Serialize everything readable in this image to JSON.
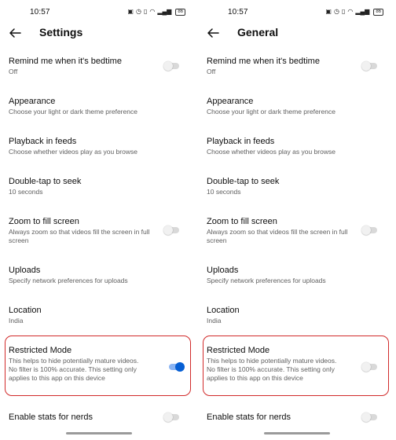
{
  "screens": [
    {
      "status": {
        "time": "10:57",
        "icons": [
          "nfc-icon",
          "alarm-icon",
          "vibrate-icon",
          "wifi-icon",
          "signal-icon"
        ],
        "battery": "86"
      },
      "header": {
        "title": "Settings"
      },
      "settings": [
        {
          "title": "Remind me when it's bedtime",
          "subtitle": "Off",
          "toggle": "off"
        },
        {
          "title": "Appearance",
          "subtitle": "Choose your light or dark theme preference"
        },
        {
          "title": "Playback in feeds",
          "subtitle": "Choose whether videos play as you browse"
        },
        {
          "title": "Double-tap to seek",
          "subtitle": "10 seconds"
        },
        {
          "title": "Zoom to fill screen",
          "subtitle": "Always zoom so that videos fill the screen in full screen",
          "toggle": "off"
        },
        {
          "title": "Uploads",
          "subtitle": "Specify network preferences for uploads"
        },
        {
          "title": "Location",
          "subtitle": "India"
        },
        {
          "title": "Restricted Mode",
          "subtitle": "This helps to hide potentially mature videos. No filter is 100% accurate. This setting only applies to this app on this device",
          "toggle": "on"
        },
        {
          "title": "Enable stats for nerds",
          "subtitle": "",
          "toggle": "off"
        }
      ]
    },
    {
      "status": {
        "time": "10:57",
        "icons": [
          "nfc-icon",
          "alarm-icon",
          "vibrate-icon",
          "wifi-icon",
          "signal-icon"
        ],
        "battery": "86"
      },
      "header": {
        "title": "General"
      },
      "settings": [
        {
          "title": "Remind me when it's bedtime",
          "subtitle": "Off",
          "toggle": "off"
        },
        {
          "title": "Appearance",
          "subtitle": "Choose your light or dark theme preference"
        },
        {
          "title": "Playback in feeds",
          "subtitle": "Choose whether videos play as you browse"
        },
        {
          "title": "Double-tap to seek",
          "subtitle": "10 seconds"
        },
        {
          "title": "Zoom to fill screen",
          "subtitle": "Always zoom so that videos fill the screen in full screen",
          "toggle": "off"
        },
        {
          "title": "Uploads",
          "subtitle": "Specify network preferences for uploads"
        },
        {
          "title": "Location",
          "subtitle": "India"
        },
        {
          "title": "Restricted Mode",
          "subtitle": "This helps to hide potentially mature videos. No filter is 100% accurate. This setting only applies to this app on this device",
          "toggle": "off"
        },
        {
          "title": "Enable stats for nerds",
          "subtitle": "",
          "toggle": "off"
        }
      ]
    }
  ],
  "colors": {
    "highlight": "#d12a2a",
    "toggle_on": "#065fd4",
    "toggle_off": "#d9d9d9"
  }
}
